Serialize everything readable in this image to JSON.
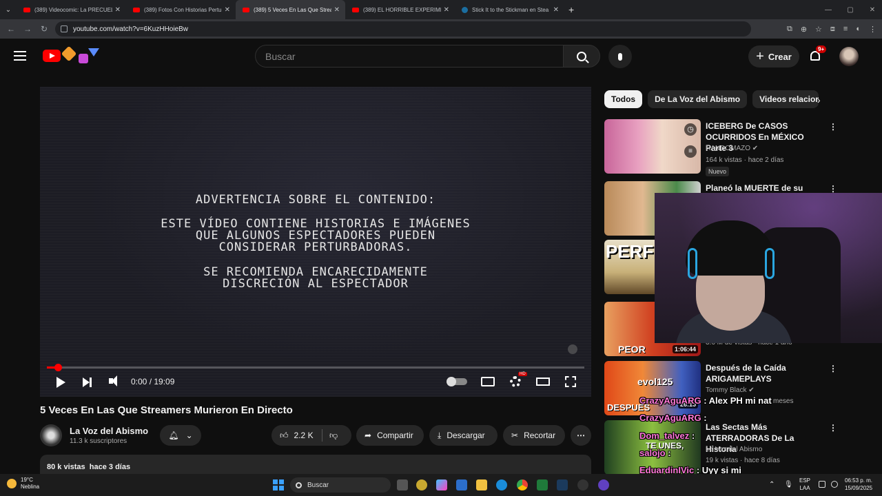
{
  "browser": {
    "tabs": [
      {
        "title": "(389) Videocomic: La PRECUELA",
        "icon": "youtube-icon"
      },
      {
        "title": "(389) Fotos Con Historias Pertu",
        "icon": "youtube-icon"
      },
      {
        "title": "(389) 5 Veces En Las Que Stream",
        "icon": "youtube-icon",
        "active": true
      },
      {
        "title": "(389) EL HORRIBLE EXPERIMEN",
        "icon": "youtube-icon"
      },
      {
        "title": "Stick It to the Stickman en Stea",
        "icon": "steam-icon"
      }
    ],
    "url": "youtube.com/watch?v=6KuzHHoieBw"
  },
  "header": {
    "search_placeholder": "Buscar",
    "create_label": "Crear",
    "notif_badge": "9+"
  },
  "player": {
    "warning_title": "ADVERTENCIA SOBRE EL CONTENIDO:",
    "warning_line1": "ESTE VÍDEO CONTIENE HISTORIAS E IMÁGENES",
    "warning_line2": "QUE ALGUNOS ESPECTADORES PUEDEN",
    "warning_line3": "CONSIDERAR PERTURBADORAS.",
    "warning_line4": "SE RECOMIENDA ENCARECIDAMENTE",
    "warning_line5": "DISCRECIÓN AL ESPECTADOR",
    "time": "0:00 / 19:09",
    "progress_fraction": 0.02,
    "hd_badge": "HD"
  },
  "video": {
    "title": "5 Veces En Las Que Streamers Murieron En Directo",
    "channel": "La Voz del Abismo",
    "subscribers": "11.3 k suscriptores",
    "likes": "2.2 K",
    "share": "Compartir",
    "download": "Descargar",
    "clip": "Recortar",
    "views": "80 k vistas",
    "date": "hace 3 días"
  },
  "sidebar": {
    "chips": [
      "Todos",
      "De La Voz del Abismo",
      "Videos relacion"
    ],
    "recs": [
      {
        "title": "ICEBERG De CASOS OCURRIDOS En MÉXICO Parte 3",
        "channel": "RANDOMAZO",
        "meta": "164 k vistas · hace 2 días",
        "badge": "Nuevo",
        "duration": ""
      },
      {
        "title": "Planeó la MUERTE de su",
        "channel": "",
        "meta": "",
        "badge": "",
        "duration": ""
      },
      {
        "title": "",
        "channel": "",
        "meta": "",
        "badge": "",
        "duration": ""
      },
      {
        "title": "",
        "channel": "",
        "meta": "3.6 M de vistas · hace 1 año",
        "badge": "",
        "duration": "1:06:44"
      },
      {
        "title": "Después de la Caída ARIGAMEPLAYS",
        "channel": "Tommy Black",
        "meta": "meses",
        "badge": "",
        "duration": "26:15"
      },
      {
        "title": "Las Sectas Más ATERRADORAS De La Historia",
        "channel": "La Voz del Abismo",
        "meta": "19 k vistas · hace 8 días",
        "badge": "",
        "duration": ""
      }
    ],
    "thumb3_text": "PERFI"
  },
  "chat": [
    {
      "user": "CrazyAguARG",
      "msg": "Alex PH mi nat"
    },
    {
      "user": "CrazyAguARG",
      "msg": ""
    },
    {
      "user": "Dom_talvez",
      "msg": ""
    },
    {
      "user": "salojo",
      "msg": ""
    },
    {
      "user": "EduardinIVic",
      "msg": "Uyy si mi"
    }
  ],
  "thumb_texts": {
    "evol": "evol125",
    "despues": "DESPUES",
    "teunes": "TE UNES,",
    "peor": "PEOR"
  },
  "taskbar": {
    "temp": "19°C",
    "weather": "Neblina",
    "search": "Buscar",
    "lang1": "ESP",
    "lang2": "LAA",
    "time": "06:53 p. m.",
    "date": "15/09/2025"
  },
  "colors": {
    "accent": "#ff0000",
    "background": "#0f0f0f"
  }
}
